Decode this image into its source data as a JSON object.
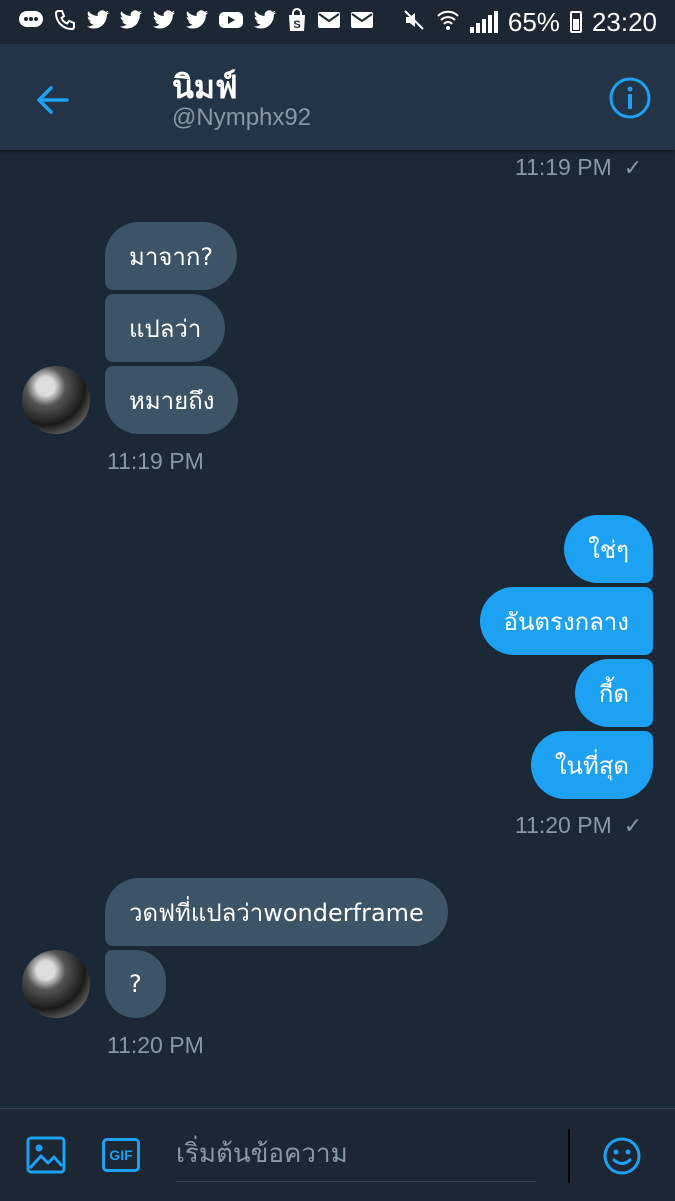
{
  "status_bar": {
    "battery": "65%",
    "time": "23:20",
    "left_icons": [
      "chat-bubble-icon",
      "phone-wifi-icon",
      "twitter-icon",
      "twitter-icon",
      "twitter-icon",
      "twitter-icon",
      "youtube-icon",
      "twitter-icon",
      "shopping-bag-icon",
      "mail-icon",
      "mail-icon"
    ],
    "right_icons": [
      "mute-icon",
      "wifi-icon",
      "signal-icon",
      "battery-icon"
    ]
  },
  "header": {
    "name": "นิมฟ์",
    "handle": "@Nymphx92"
  },
  "messages": {
    "ts_top": "11:19 PM",
    "group1": [
      "มาจาก?",
      "แปลว่า",
      "หมายถึง"
    ],
    "ts_group1": "11:19 PM",
    "group2": [
      "ใช่ๆ",
      "อันตรงกลาง",
      "กี้ด",
      "ในที่สุด"
    ],
    "ts_group2": "11:20 PM",
    "group3": [
      "วดฟที่แปลว่าwonderframe",
      "?"
    ],
    "ts_group3": "11:20 PM",
    "read_check": "✓"
  },
  "composer": {
    "placeholder": "เริ่มต้นข้อความ",
    "gif_label": "GIF"
  },
  "colors": {
    "background": "#1b2836",
    "header": "#243447",
    "accent": "#1da1f2",
    "incoming_bubble": "#3d5466",
    "muted_text": "#8899a6"
  }
}
